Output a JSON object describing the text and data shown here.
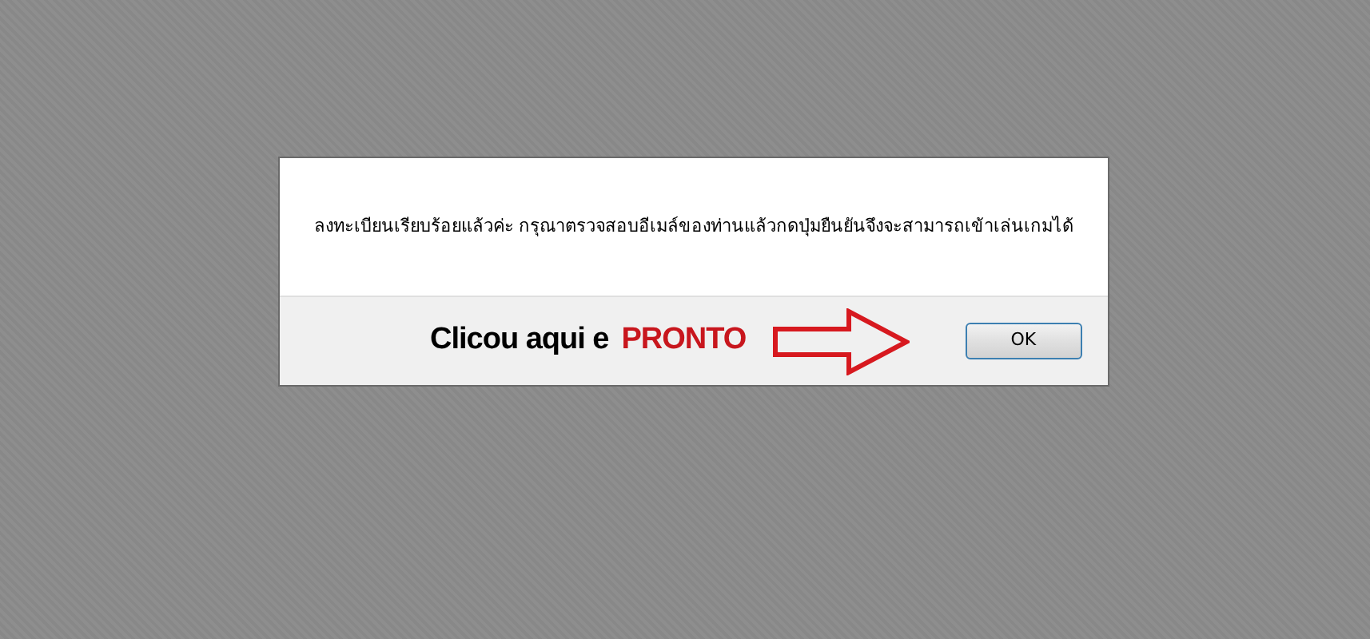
{
  "dialog": {
    "message": "ลงทะเบียนเรียบร้อยแล้วค่ะ กรุณาตรวจสอบอีเมล์ของท่านแล้วกดปุ่มยืนยันจึงจะสามารถเข้าเล่นเกมได้",
    "buttons": [
      "OK"
    ]
  },
  "annotation": {
    "text": "Clicou aqui e",
    "highlight": "PRONTO"
  }
}
